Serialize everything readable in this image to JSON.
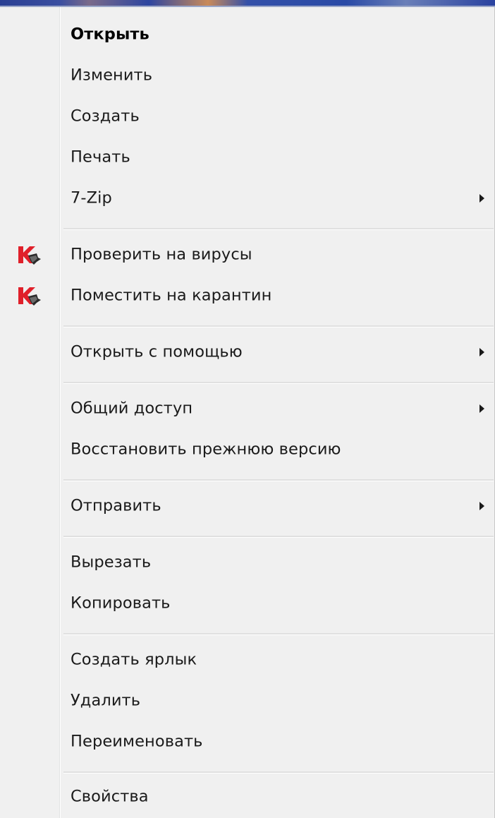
{
  "context_menu": {
    "items": [
      {
        "label": "Открыть",
        "default": true
      },
      {
        "label": "Изменить"
      },
      {
        "label": "Создать"
      },
      {
        "label": "Печать"
      },
      {
        "label": "7-Zip",
        "submenu": true
      },
      {
        "label": "Проверить на вирусы",
        "icon": "kaspersky-icon"
      },
      {
        "label": "Поместить на карантин",
        "icon": "kaspersky-icon"
      },
      {
        "label": "Открыть с помощью",
        "submenu": true
      },
      {
        "label": "Общий доступ",
        "submenu": true
      },
      {
        "label": "Восстановить прежнюю версию"
      },
      {
        "label": "Отправить",
        "submenu": true
      },
      {
        "label": "Вырезать"
      },
      {
        "label": "Копировать"
      },
      {
        "label": "Создать ярлык"
      },
      {
        "label": "Удалить"
      },
      {
        "label": "Переименовать"
      },
      {
        "label": "Свойства"
      }
    ]
  },
  "colors": {
    "menu_background": "#f0f0f0",
    "text": "#1a1a1a",
    "kaspersky_red": "#e0202a"
  }
}
